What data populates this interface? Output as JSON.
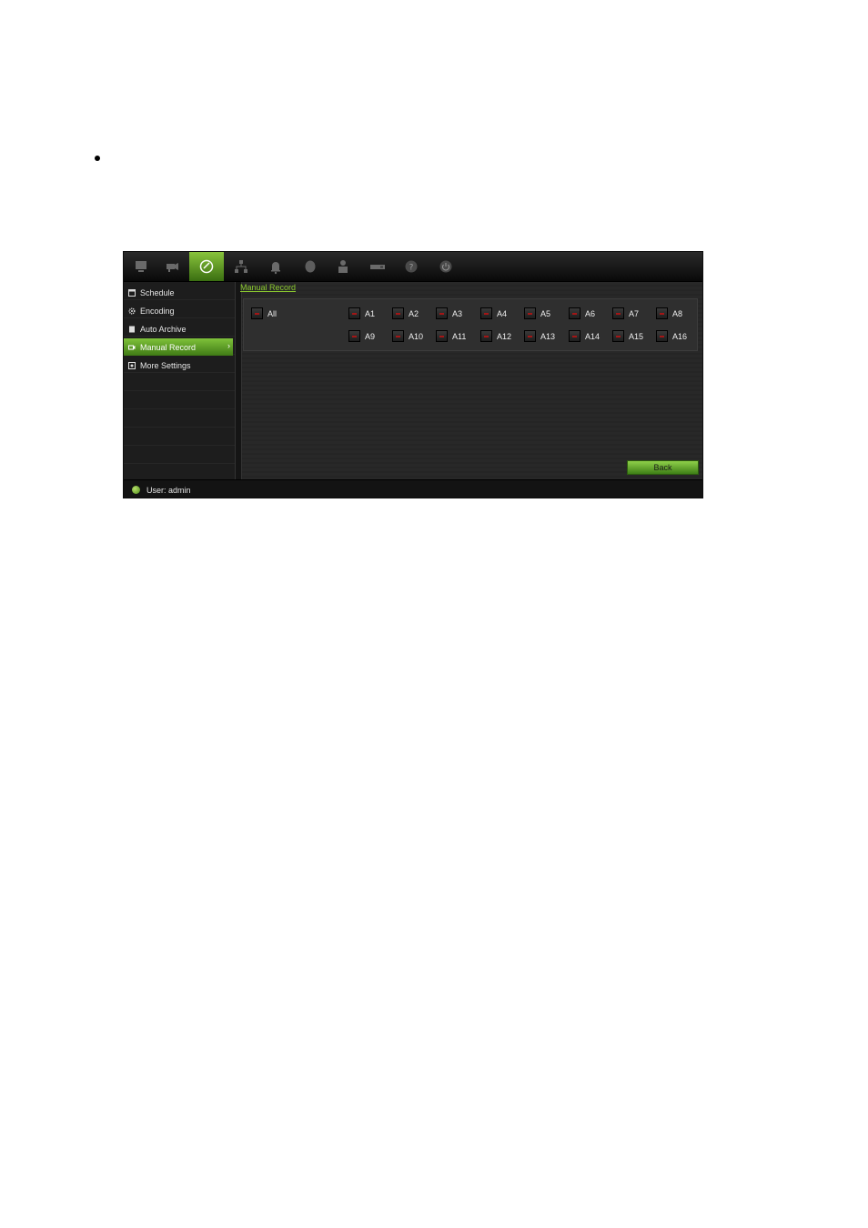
{
  "topbar": {
    "icons": [
      {
        "name": "monitor-icon"
      },
      {
        "name": "camera-icon"
      },
      {
        "name": "record-icon",
        "active": true
      },
      {
        "name": "network-icon"
      },
      {
        "name": "alarm-bell-icon"
      },
      {
        "name": "device-icon"
      },
      {
        "name": "user-lock-icon"
      },
      {
        "name": "system-icon"
      },
      {
        "name": "help-icon"
      },
      {
        "name": "power-icon"
      }
    ]
  },
  "sidebar": {
    "items": [
      {
        "label": "Schedule",
        "icon": "calendar-icon"
      },
      {
        "label": "Encoding",
        "icon": "gear-icon"
      },
      {
        "label": "Auto Archive",
        "icon": "archive-icon"
      },
      {
        "label": "Manual Record",
        "icon": "manual-record-icon",
        "active": true
      },
      {
        "label": "More Settings",
        "icon": "settings-icon"
      }
    ]
  },
  "content": {
    "breadcrumb": "Manual Record",
    "all_label": "All",
    "row1": [
      "A1",
      "A2",
      "A3",
      "A4",
      "A5",
      "A6",
      "A7",
      "A8"
    ],
    "row2": [
      "A9",
      "A10",
      "A11",
      "A12",
      "A13",
      "A14",
      "A15",
      "A16"
    ],
    "back_label": "Back"
  },
  "status": {
    "user_text": "User: admin"
  },
  "colors": {
    "accent": "#7fc23a",
    "checkbox_mark": "#a31616"
  }
}
